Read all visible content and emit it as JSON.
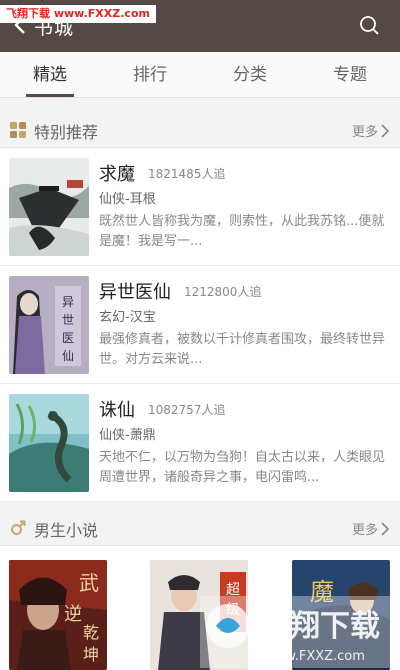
{
  "topbar": {
    "back_icon": "chevron-left-icon",
    "title": "书城",
    "search_icon": "search-icon",
    "watermark": "飞翔下载 www.FXXZ.com"
  },
  "tabs": [
    {
      "label": "精选",
      "active": true
    },
    {
      "label": "排行",
      "active": false
    },
    {
      "label": "分类",
      "active": false
    },
    {
      "label": "专题",
      "active": false
    }
  ],
  "featured": {
    "title": "特别推荐",
    "icon": "grid-icon",
    "more": "更多",
    "books": [
      {
        "title": "求魔",
        "follows": "1821485人追",
        "category": "仙侠-耳根",
        "desc": "既然世人皆称我为魔，则索性，从此我苏铭...便就是魔！我是写一..."
      },
      {
        "title": "异世医仙",
        "follows": "1212800人追",
        "category": "玄幻-汉宝",
        "desc": "最强修真者，被数以千计修真者围攻，最终转世异世。对方云来说..."
      },
      {
        "title": "诛仙",
        "follows": "1082757人追",
        "category": "仙侠-萧鼎",
        "desc": "天地不仁，以万物为刍狗！自太古以来，人类眼见周遭世界，诸般奇异之事，电闪雷鸣..."
      }
    ]
  },
  "male": {
    "title": "男生小说",
    "icon": "male-icon",
    "more": "更多"
  },
  "accent": "#554946"
}
